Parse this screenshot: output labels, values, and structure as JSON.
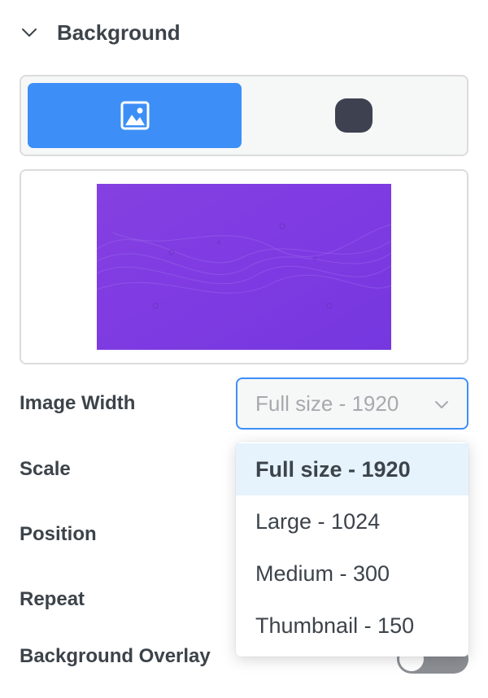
{
  "section": {
    "title": "Background",
    "expanded": true
  },
  "type_toggle": {
    "options": [
      {
        "icon": "image-icon",
        "active": true
      },
      {
        "icon": "color-swatch-icon",
        "active": false
      }
    ],
    "accent": "#3d8ff7"
  },
  "fields": {
    "image_width": {
      "label": "Image Width",
      "value": "Full size - 1920",
      "options": [
        "Full size - 1920",
        "Large - 1024",
        "Medium - 300",
        "Thumbnail - 150"
      ]
    },
    "scale_label": "Scale",
    "position_label": "Position",
    "repeat_label": "Repeat",
    "overlay": {
      "label": "Background Overlay",
      "enabled": false
    }
  }
}
